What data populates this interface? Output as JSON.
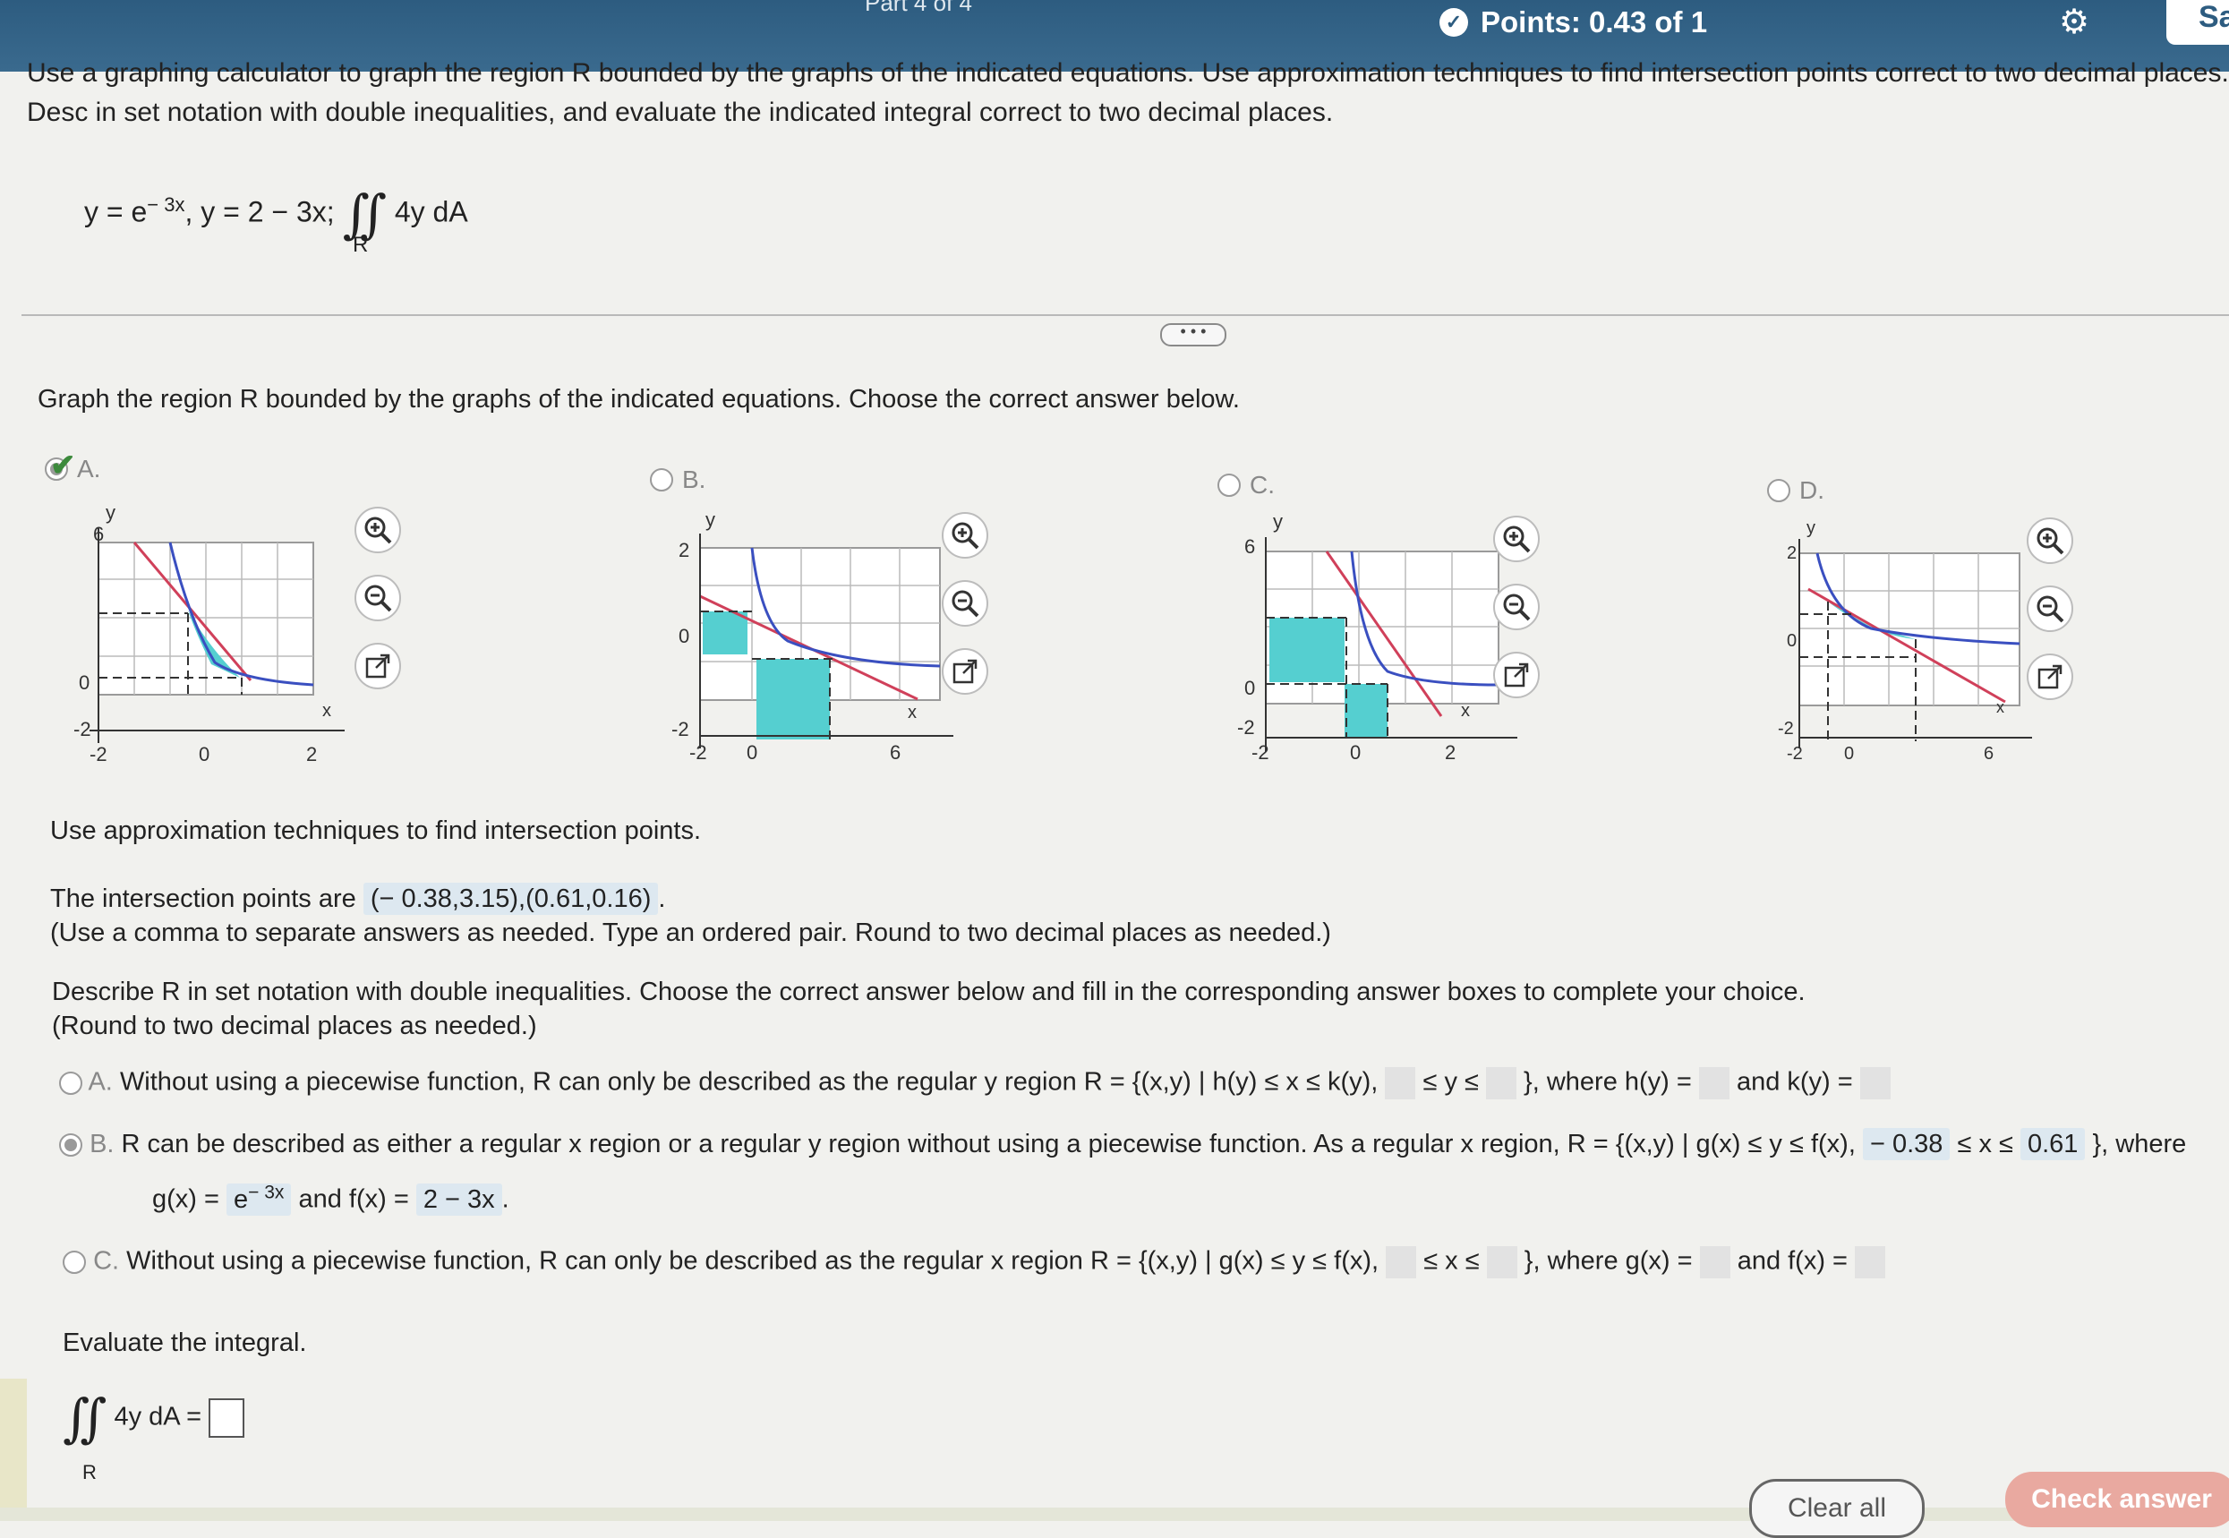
{
  "header": {
    "part": "Part 4 of 4",
    "points": "Points: 0.43 of 1",
    "save_label": "Sa"
  },
  "problem": {
    "statement": "Use a graphing calculator to graph the region R bounded by the graphs of the indicated equations. Use approximation techniques to find intersection points correct to two decimal places. Desc in set notation with double inequalities, and evaluate the indicated integral correct to two decimal places.",
    "eq1_base": "y = e",
    "eq1_exp": "− 3x",
    "eq2": ", y = 2 − 3x;",
    "integrand": "4y dA",
    "region": "R"
  },
  "more_label": "• • •",
  "q1": {
    "prompt": "Graph the region R bounded by the graphs of the indicated equations. Choose the correct answer below.",
    "options": [
      {
        "label": "A.",
        "selected": true,
        "correct": true
      },
      {
        "label": "B.",
        "selected": false
      },
      {
        "label": "C.",
        "selected": false
      },
      {
        "label": "D.",
        "selected": false
      }
    ],
    "graphs": [
      {
        "ylabels": [
          "6",
          "0",
          "-2"
        ],
        "xlabels": [
          "-2",
          "0",
          "2"
        ],
        "axis_x": "x",
        "axis_y": "y"
      },
      {
        "ylabels": [
          "2",
          "0",
          "-2"
        ],
        "xlabels": [
          "-2",
          "0",
          "6"
        ],
        "axis_x": "x",
        "axis_y": "y"
      },
      {
        "ylabels": [
          "6",
          "0",
          "-2"
        ],
        "xlabels": [
          "-2",
          "0",
          "2"
        ],
        "axis_x": "x",
        "axis_y": "y"
      },
      {
        "ylabels": [
          "2",
          "0",
          "-2"
        ],
        "xlabels": [
          "-2",
          "0",
          "6"
        ],
        "axis_x": "x",
        "axis_y": "y"
      }
    ]
  },
  "q2": {
    "prompt": "Use approximation techniques to find intersection points.",
    "answer_prefix": "The intersection points are",
    "answer": "(− 0.38,3.15),(0.61,0.16)",
    "hint": "(Use a comma to separate answers as needed. Type an ordered pair. Round to two decimal places as needed.)"
  },
  "q3": {
    "prompt": "Describe R in set notation with double inequalities. Choose the correct answer below and fill in the corresponding answer boxes to complete your choice.",
    "hint": "(Round to two decimal places as needed.)",
    "optA": {
      "label": "A.",
      "text": "Without using a piecewise function, R can only be described as the regular y region R = {(x,y) | h(y) ≤ x ≤ k(y),",
      "mid": "≤ y ≤",
      "end": "}, where h(y) =",
      "and": "and k(y) ="
    },
    "optB": {
      "label": "B.",
      "text": "R can be described as either a regular x region or a regular y region without using a piecewise function. As a regular x region, R = {(x,y) | g(x) ≤ y ≤ f(x),",
      "lower": "− 0.38",
      "mid": "≤ x ≤",
      "upper": "0.61",
      "end": "}, where",
      "g_prefix": "g(x) =",
      "g_base": "e",
      "g_exp": "− 3x",
      "and": "and f(x) =",
      "f_val": "2 − 3x"
    },
    "optC": {
      "label": "C.",
      "text": "Without using a piecewise function, R can only be described as the regular x region R = {(x,y) | g(x) ≤ y ≤ f(x),",
      "mid": "≤ x ≤",
      "end": "}, where g(x) =",
      "and": "and f(x) ="
    }
  },
  "q4": {
    "prompt": "Evaluate the integral.",
    "integrand": "4y dA =",
    "region": "R"
  },
  "footer": {
    "clear": "Clear all",
    "check": "Check answer"
  },
  "colors": {
    "header": "#2d5c80",
    "fill": "#55cfd0",
    "line_red": "#d0405a",
    "line_blue": "#3a4fc0"
  }
}
